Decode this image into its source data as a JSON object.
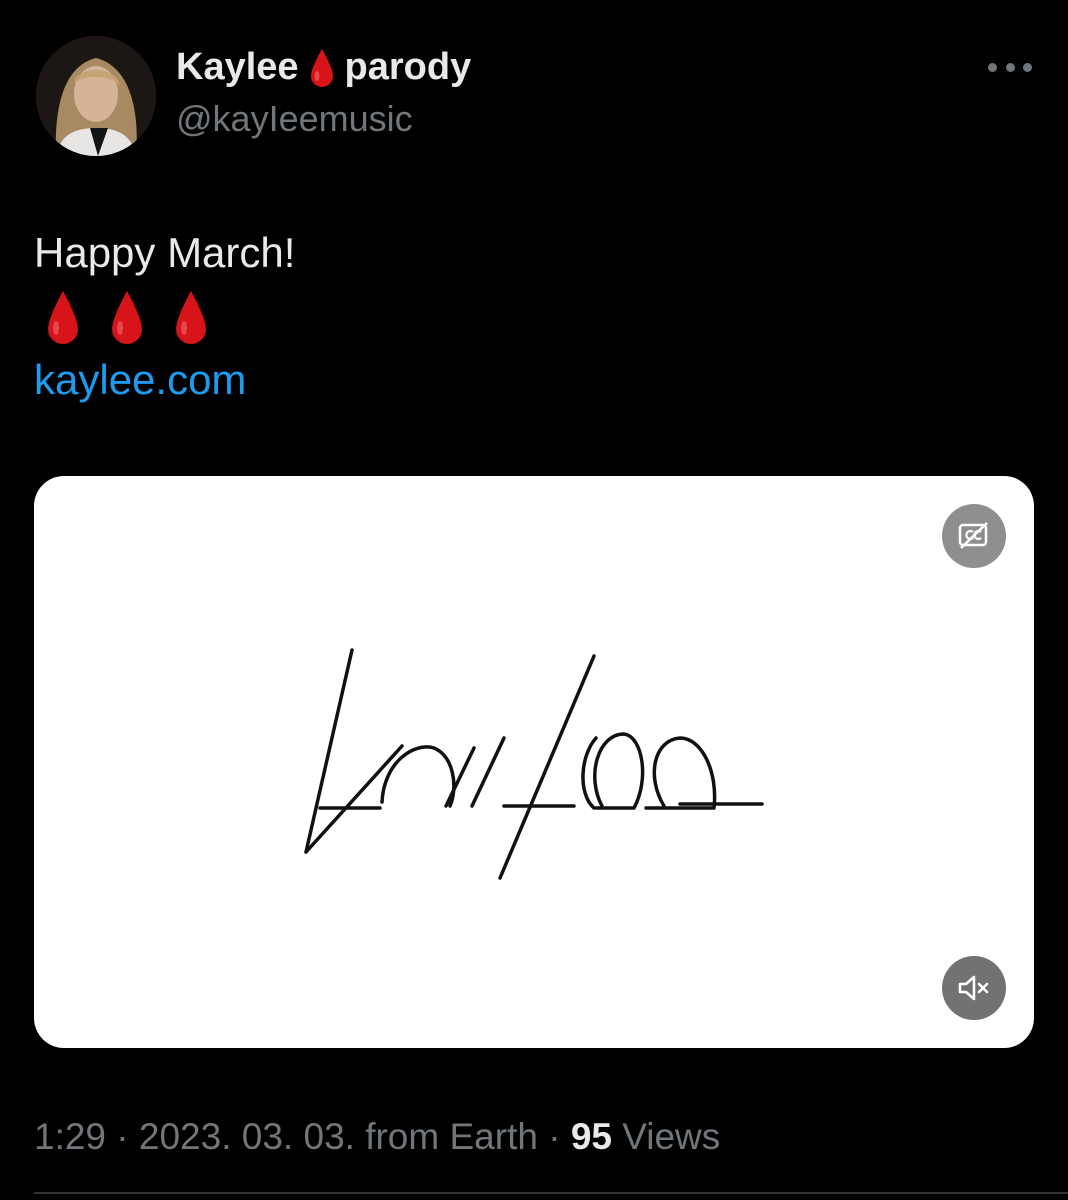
{
  "author": {
    "name": "Kaylee",
    "name_suffix": "parody",
    "handle": "@kayIeemusic",
    "avatar_icon": "profile-photo"
  },
  "tweet": {
    "text": "Happy March!",
    "emoji_count": 3,
    "emoji_icon": "drop-of-blood-icon",
    "link": "kaylee.com"
  },
  "media": {
    "logo_icon": "kaylee-logo",
    "captions_icon": "captions-off-icon",
    "mute_icon": "muted-speaker-icon"
  },
  "meta": {
    "time": "1:29",
    "separator": "·",
    "date": "2023. 03. 03. from Earth",
    "views_count": "95",
    "views_label": "Views"
  },
  "colors": {
    "background": "#000000",
    "text": "#e7e9ea",
    "secondary": "#71767b",
    "link": "#1d9bf0",
    "drop": "#d8141b"
  }
}
